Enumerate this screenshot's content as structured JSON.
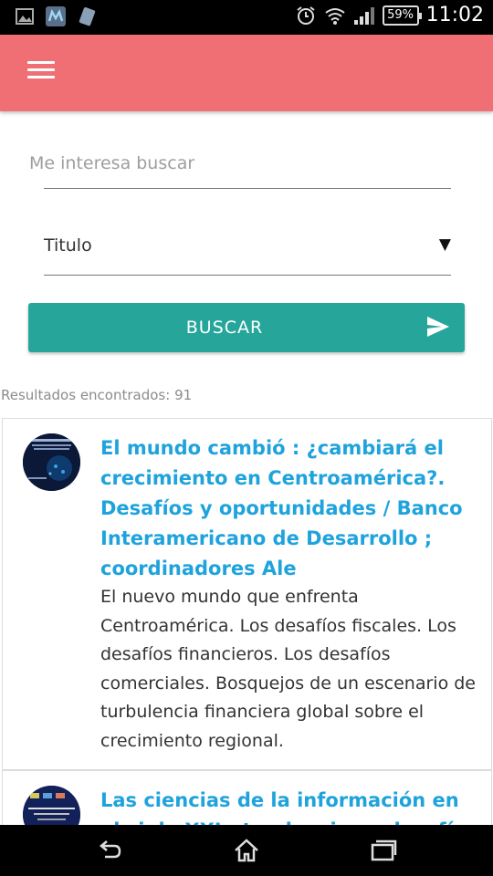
{
  "status_bar": {
    "battery": "59%",
    "time": "11:02"
  },
  "app_bar": {
    "menu_icon": "hamburger-menu-icon"
  },
  "search": {
    "placeholder": "Me interesa buscar",
    "value": "",
    "field_select": "Titulo",
    "button_label": "BUSCAR",
    "button_color": "#26a69a"
  },
  "results": {
    "count_text": "Resultados encontrados: 91",
    "items": [
      {
        "title": "El mundo cambió : ¿cambiará el crecimiento en Centroamérica?. Desafíos y oportunidades / Banco Interamericano de Desarrollo ; coordinadores Ale",
        "description": "El nuevo mundo que enfrenta Centroamérica.  Los desafíos fiscales.  Los desafíos financieros.  Los desafíos comerciales.  Bosquejos de un escenario de turbulencia financiera global sobre el crecimiento regional."
      },
      {
        "title": "Las ciencias de la información en el siglo XXI : tendencias y desafíos en el",
        "description": ""
      }
    ]
  },
  "colors": {
    "appbar": "#ef6f74",
    "title_link": "#1fa3dc"
  }
}
